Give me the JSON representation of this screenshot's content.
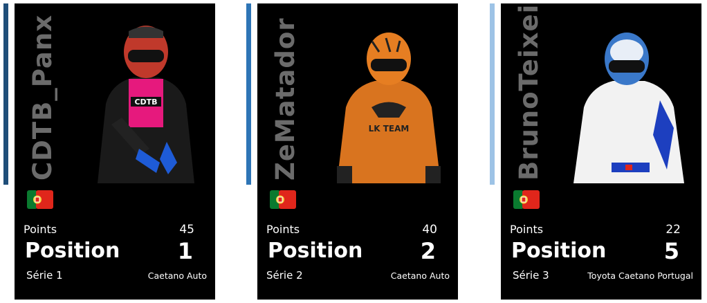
{
  "accent_colors": [
    "#1f4e79",
    "#2e75b6",
    "#9dc3e6"
  ],
  "cards": [
    {
      "driver": "CDTB_Panx",
      "flag_icon": "portugal-flag-icon",
      "points_label": "Points",
      "points": "45",
      "position_label": "Position",
      "position": "1",
      "series": "Série 1",
      "team": "Caetano Auto",
      "helmet_color": "#c0392b",
      "suit_color": "#1a1a1a",
      "accent": "#e6197d"
    },
    {
      "driver": "ZeMatador",
      "flag_icon": "portugal-flag-icon",
      "points_label": "Points",
      "points": "40",
      "position_label": "Position",
      "position": "2",
      "series": "Série 2",
      "team": "Caetano Auto",
      "helmet_color": "#e67e22",
      "suit_color": "#d9741f",
      "accent": "#222222"
    },
    {
      "driver": "BrunoTeixei",
      "flag_icon": "portugal-flag-icon",
      "points_label": "Points",
      "points": "22",
      "position_label": "Position",
      "position": "5",
      "series": "Série 3",
      "team": "Toyota Caetano Portugal",
      "helmet_color": "#3a78c9",
      "suit_color": "#f2f2f2",
      "accent": "#1d3fbf"
    }
  ]
}
